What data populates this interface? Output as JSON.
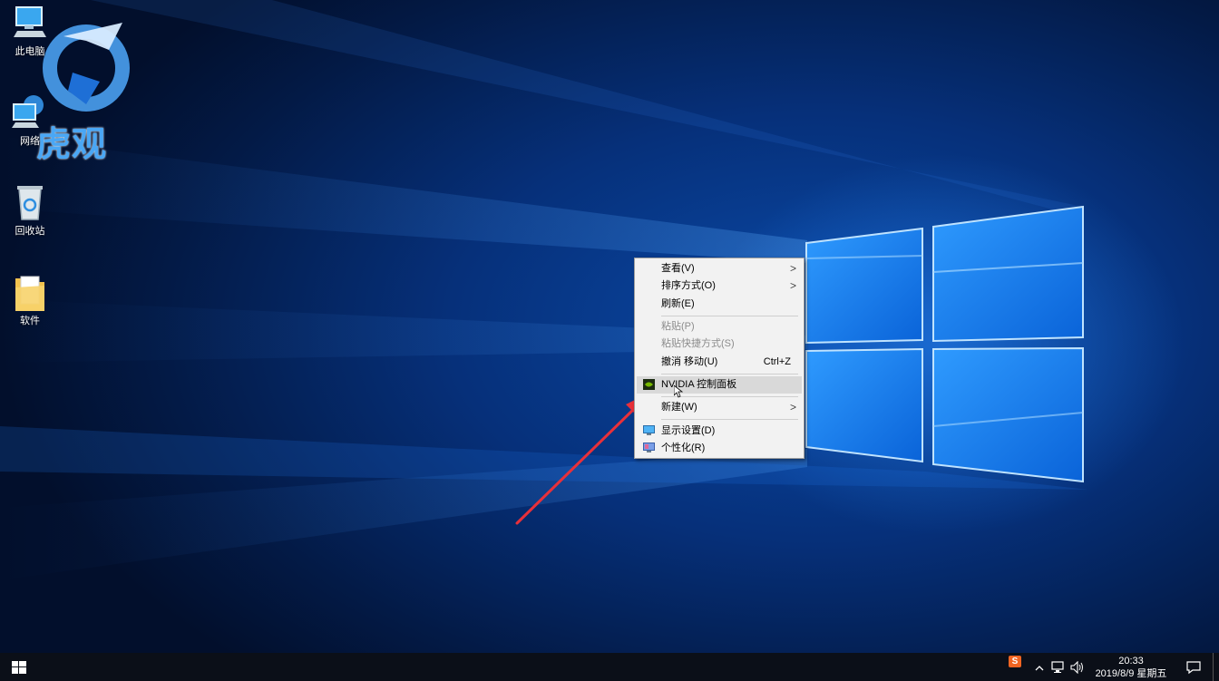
{
  "desktop": {
    "icons": [
      {
        "label": "此电脑",
        "icon": "computer-icon"
      },
      {
        "label": "网络",
        "icon": "network-icon"
      },
      {
        "label": "回收站",
        "icon": "recycle-bin-icon"
      },
      {
        "label": "软件",
        "icon": "folder-icon"
      }
    ],
    "watermark": "虎观"
  },
  "context_menu": {
    "items": [
      {
        "label": "查看(V)",
        "submenu": true
      },
      {
        "label": "排序方式(O)",
        "submenu": true
      },
      {
        "label": "刷新(E)"
      },
      {
        "label": "粘贴(P)",
        "disabled": true
      },
      {
        "label": "粘贴快捷方式(S)",
        "disabled": true
      },
      {
        "label": "撤消 移动(U)",
        "shortcut": "Ctrl+Z"
      },
      {
        "label": "NVIDIA 控制面板",
        "icon": "nvidia-icon",
        "highlighted": true
      },
      {
        "label": "新建(W)",
        "submenu": true
      },
      {
        "label": "显示设置(D)",
        "icon": "display-icon"
      },
      {
        "label": "个性化(R)",
        "icon": "personalize-icon"
      }
    ],
    "submenu_glyph": ">"
  },
  "taskbar": {
    "time": "20:33",
    "date": "2019/8/9 星期五",
    "tray_icons": [
      "sogou-input-icon",
      "network-icon",
      "volume-icon",
      "speaker-icon"
    ],
    "ime_label": "S"
  },
  "colors": {
    "arrow": "#e8303a",
    "menu_highlight": "#d9d9d9",
    "taskbar": "#0b0f18"
  }
}
